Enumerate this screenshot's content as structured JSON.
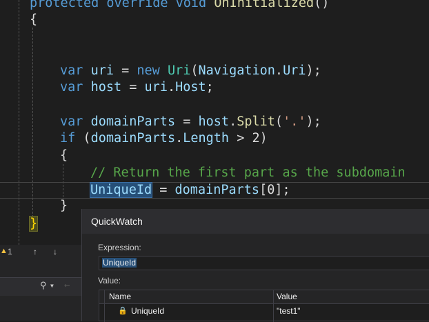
{
  "editor": {
    "lines": {
      "l0": {
        "kw1": "protected",
        "kw2": "override",
        "kw3": "void",
        "name": "OnInitialized",
        "rest": "()"
      },
      "l1": {
        "text": "{"
      },
      "l4": {
        "kw": "var",
        "id": "uri",
        "eq": " = ",
        "kw2": "new",
        "ty": "Uri",
        "open": "(",
        "id2": "Navigation",
        "dot": ".",
        "id3": "Uri",
        "close": ");"
      },
      "l5": {
        "kw": "var",
        "id": "host",
        "eq": " = ",
        "id2": "uri",
        "dot": ".",
        "id3": "Host",
        "close": ";"
      },
      "l7": {
        "kw": "var",
        "id": "domainParts",
        "eq": " = ",
        "id2": "host",
        "dot": ".",
        "mt": "Split",
        "open": "(",
        "st": "'.'",
        "close": ");"
      },
      "l8": {
        "kw": "if",
        "open": " (",
        "id": "domainParts",
        "dot": ".",
        "id2": "Length",
        "rest": " > 2)"
      },
      "l9": {
        "text": "{"
      },
      "l10": {
        "comment": "// Return the first part as the subdomain"
      },
      "l11": {
        "id": "UniqueId",
        "eq": " = ",
        "id2": "domainParts",
        "rest": "[0];"
      },
      "l12": {
        "text": "}"
      },
      "l13": {
        "text": "}"
      }
    }
  },
  "status": {
    "count": "1",
    "up_icon": "up-arrow-icon",
    "down_icon": "down-arrow-icon"
  },
  "quickwatch": {
    "title": "QuickWatch",
    "expression_label": "Expression:",
    "expression_value": "UniqueId",
    "value_label": "Value:",
    "columns": [
      "Name",
      "Value"
    ],
    "rows": [
      {
        "name": "UniqueId",
        "value": "\"test1\""
      }
    ]
  },
  "colors": {
    "background": "#1e1e1e",
    "keyword": "#569cd6",
    "type": "#4ec9b0",
    "identifier": "#9cdcfe",
    "comment": "#57a64a",
    "selection": "#264f78"
  }
}
